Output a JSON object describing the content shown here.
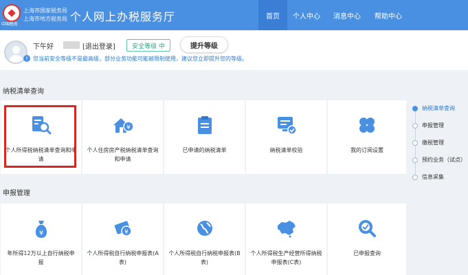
{
  "header": {
    "bureau_line1": "上海市国家税务局",
    "bureau_line2": "上海市地方税务局",
    "emblem_text": "中国税务",
    "site_title": "个人网上办税服务厅",
    "nav": [
      "首页",
      "个人中心",
      "消息中心",
      "帮助中心"
    ],
    "brand_color": "#4a90e2"
  },
  "user": {
    "greeting": "下午好",
    "logout": "[退出登录]",
    "security_level": "安全等级 中",
    "upgrade": "提升等级",
    "notice": "您当前安全等级不是最高级，部分业务功能可能被限制使用，建议您立即提升您的等级。"
  },
  "sections": {
    "tax_list": {
      "title": "纳税清单查询",
      "cards": [
        {
          "label": "个人所得税纳税清单查询和申请",
          "icon": "search-doc-icon"
        },
        {
          "label": "个人住房房产税纳税清单查询和申请",
          "icon": "house-yen-icon"
        },
        {
          "label": "已申请的纳税清单",
          "icon": "clipboard-list-icon"
        },
        {
          "label": "纳税清单校验",
          "icon": "monitor-check-icon"
        },
        {
          "label": "我的订阅设置",
          "icon": "four-leaf-icon"
        }
      ]
    },
    "declare": {
      "title": "申报管理",
      "cards": [
        {
          "label": "年所得12万以上自行纳税申报",
          "icon": "money-bag-icon"
        },
        {
          "label": "个人所得税自行纳税申报表(A表)",
          "icon": "tag-ticket-icon"
        },
        {
          "label": "个人所得税自行纳税申报表(B表)",
          "icon": "globe-icon"
        },
        {
          "label": "个人所得税生产经营所得纳税申报表(C表)",
          "icon": "china-map-icon"
        },
        {
          "label": "已申报查询",
          "icon": "magnifier-icon"
        }
      ]
    }
  },
  "side_nav": [
    "纳税清单查询",
    "申报管理",
    "缴税管理",
    "预约业务（试点）",
    "信息采集"
  ]
}
